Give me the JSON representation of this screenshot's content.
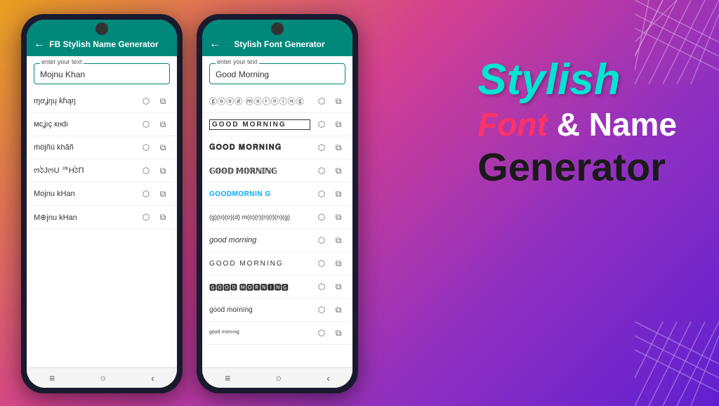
{
  "background": {
    "gradient_start": "#e8a020",
    "gradient_end": "#6020d0"
  },
  "phone1": {
    "header_title": "FB Stylish Name Generator",
    "input_label": "enter your text",
    "input_value": "Mojnu Khan",
    "results": [
      {
        "text": "ɱơʝŋų ƙɦąŋ",
        "id": "result-1"
      },
      {
        "text": "мєʝıç кнdı",
        "id": "result-2"
      },
      {
        "text": "ṁöjñú khãñ",
        "id": "result-3"
      },
      {
        "text": "ოঠJოU ᄏHঠП",
        "id": "result-4"
      },
      {
        "text": "Mojnu kHan",
        "id": "result-5"
      },
      {
        "text": "M⊕jnu kHan",
        "id": "result-6"
      }
    ],
    "nav": [
      "≡",
      "○",
      "‹"
    ]
  },
  "phone2": {
    "header_title": "Stylish Font Generator",
    "input_label": "enter your text",
    "input_value": "Good Morning",
    "results": [
      {
        "text": "ⓖⓞⓞⓓ ⓜⓞⓡⓝⓘⓝⓖ",
        "style": "circled",
        "id": "result-p2-1"
      },
      {
        "text": "GOOD MORNING",
        "style": "boxed",
        "id": "result-p2-2"
      },
      {
        "text": "𝐆𝐎𝐎𝐃 𝐌𝐎𝐑𝐍𝐈𝐍𝐆",
        "style": "bold-outlined",
        "id": "result-p2-3"
      },
      {
        "text": "𝔾𝕆𝕆𝔻 𝕄𝕆ℝℕ𝕀ℕ𝔾",
        "style": "blackletter",
        "id": "result-p2-4"
      },
      {
        "text": "GOODMORNIN G",
        "style": "colorful",
        "id": "result-p2-5"
      },
      {
        "text": "(g)(o)(o)(d) m(o)(r)(n)(i)(n)(g)",
        "style": "parentheses",
        "id": "result-p2-6"
      },
      {
        "text": "good morning",
        "style": "italic",
        "id": "result-p2-7"
      },
      {
        "text": "GOOD MORNING",
        "style": "caps",
        "id": "result-p2-8"
      },
      {
        "text": "🅶🅾🅾🅳 🅼🅾🆁🅽🅸🅽🅶",
        "style": "fancy1",
        "id": "result-p2-9"
      },
      {
        "text": "ġȯȯḋ ṁȯṙṅïṅġ",
        "style": "fancy2",
        "id": "result-p2-10"
      },
      {
        "text": "ᵍᵒᵒᵈ ᵐᵒʳⁿⁱⁿᵍ",
        "style": "fancy3",
        "id": "result-p2-11"
      }
    ],
    "nav": [
      "≡",
      "○",
      "‹"
    ]
  },
  "promo": {
    "stylish": "Stylish",
    "font": "Font",
    "and": "& Name",
    "generator": "Generator"
  },
  "icons": {
    "share": "⮜",
    "copy": "⧉",
    "back": "←"
  }
}
